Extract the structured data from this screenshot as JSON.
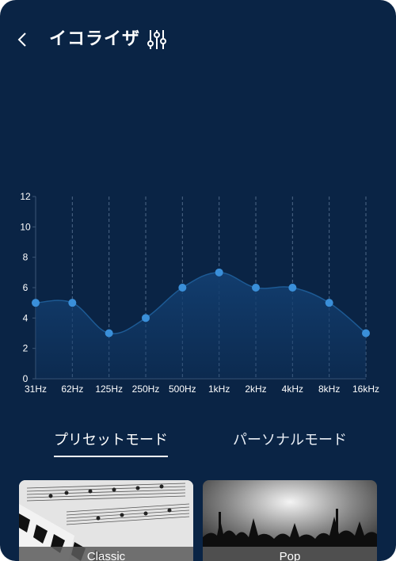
{
  "header": {
    "title": "イコライザ"
  },
  "colors": {
    "background": "#0a2445",
    "accent": "#3a8fd9",
    "curve_fill": "#123d6e",
    "text": "#ffffff"
  },
  "chart_data": {
    "type": "area",
    "title": "",
    "xlabel": "",
    "ylabel": "",
    "categories": [
      "31Hz",
      "62Hz",
      "125Hz",
      "250Hz",
      "500Hz",
      "1kHz",
      "2kHz",
      "4kHz",
      "8kHz",
      "16kHz"
    ],
    "values": [
      5,
      5,
      3,
      4,
      6,
      7,
      6,
      6,
      5,
      3
    ],
    "ylim": [
      0,
      12
    ],
    "yticks": [
      "0",
      "2",
      "4",
      "6",
      "8",
      "10",
      "12"
    ],
    "grid": "vertical dashed lines at each band"
  },
  "tabs": {
    "preset": "プリセットモード",
    "personal": "パーソナルモード",
    "active": "preset"
  },
  "presets": [
    {
      "label": "Classic"
    },
    {
      "label": "Pop"
    }
  ]
}
